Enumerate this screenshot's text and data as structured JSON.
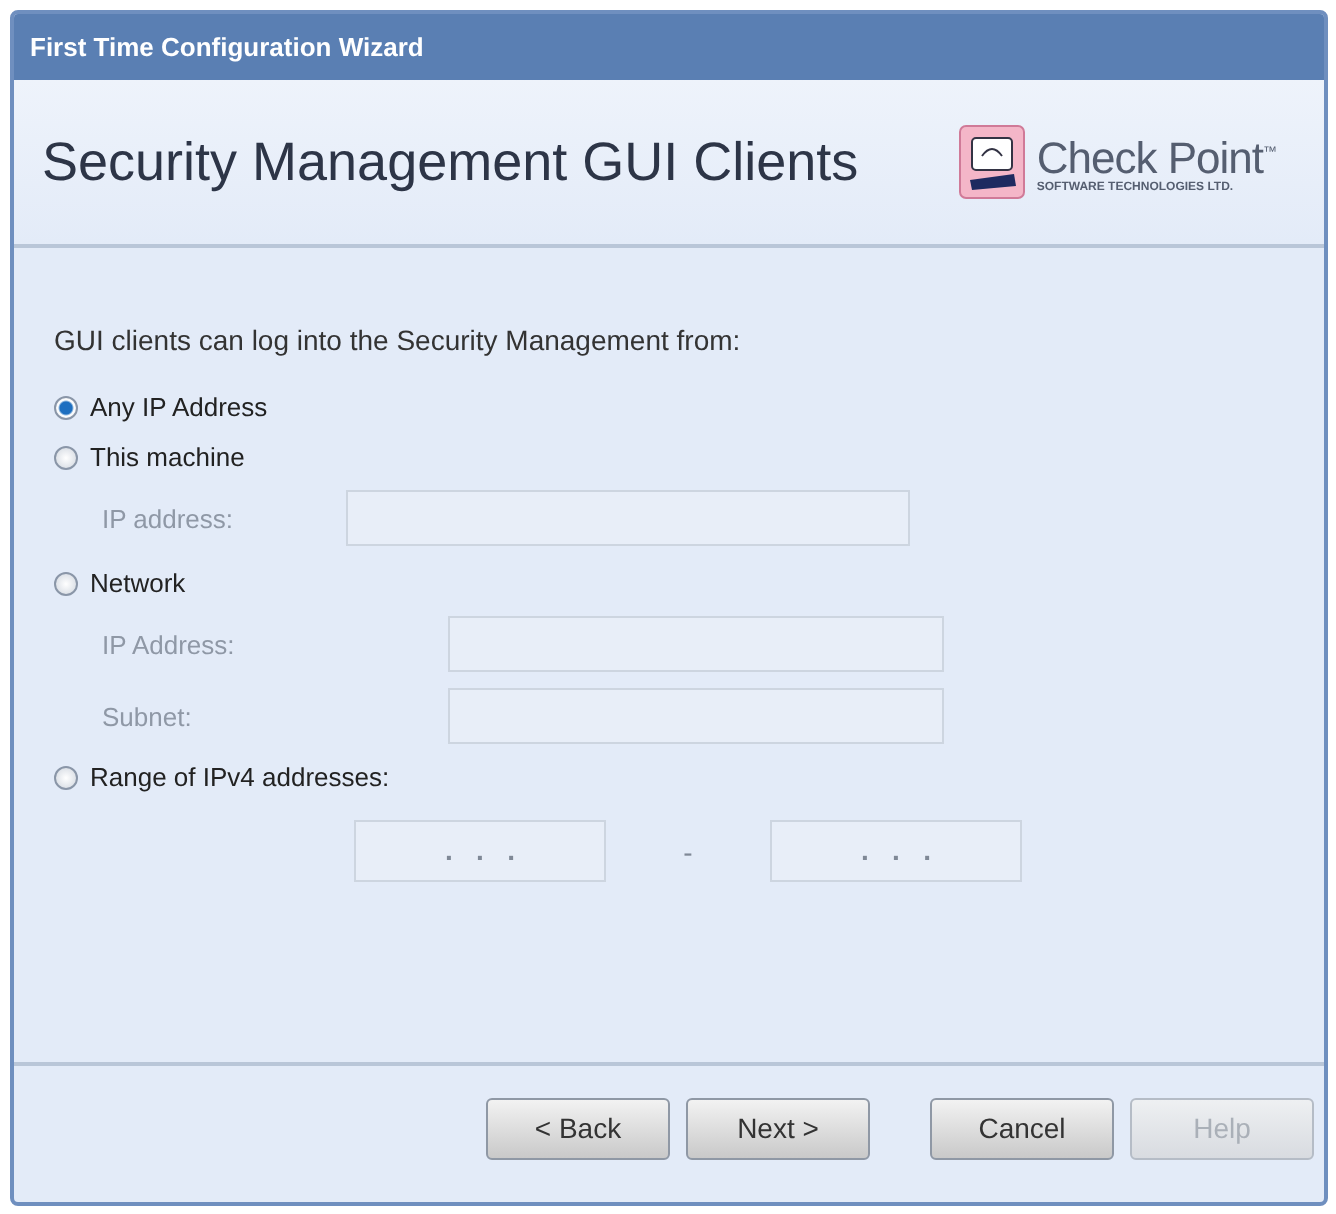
{
  "window": {
    "title": "First Time Configuration Wizard"
  },
  "header": {
    "title": "Security Management GUI Clients",
    "logo": {
      "name": "Check Point",
      "trademark": "™",
      "tagline": "SOFTWARE TECHNOLOGIES LTD."
    }
  },
  "intro": "GUI clients can log into the Security Management from:",
  "options": [
    {
      "kind": "plain",
      "label": "Any IP Address",
      "selected": true
    },
    {
      "kind": "fields",
      "label": "This machine",
      "selected": false,
      "fields": [
        {
          "label": "IP address:",
          "disabled": true
        }
      ]
    },
    {
      "kind": "fields",
      "label": "Network",
      "selected": false,
      "fields": [
        {
          "label": "IP Address:",
          "disabled": true
        },
        {
          "label": "Subnet:",
          "disabled": true
        }
      ]
    },
    {
      "kind": "range",
      "label": "Range of IPv4 addresses:",
      "selected": false,
      "separator": "-",
      "range_fields": [
        {
          "mask": ".   .   .",
          "disabled": true
        },
        {
          "mask": ".   .   .",
          "disabled": true
        }
      ]
    }
  ],
  "buttons": [
    {
      "label": "< Back",
      "disabled": false
    },
    {
      "label": "Next >",
      "disabled": false
    },
    {
      "label": "Cancel",
      "disabled": false
    },
    {
      "label": "Help",
      "disabled": true
    }
  ]
}
